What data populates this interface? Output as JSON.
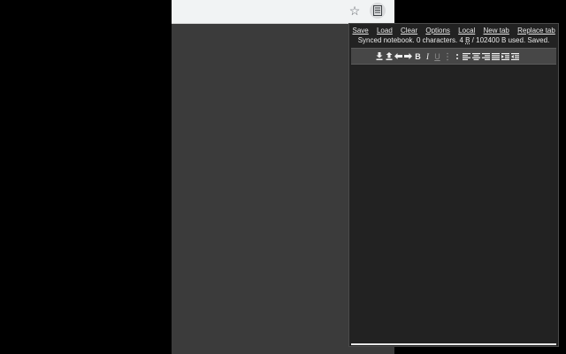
{
  "browser": {
    "bookmark_icon": "star-icon",
    "extension_icon": "notebook-icon"
  },
  "menu": {
    "save": "Save",
    "load": "Load",
    "clear": "Clear",
    "options": "Options",
    "local": "Local",
    "new_tab": "New tab",
    "replace_tab": "Replace tab"
  },
  "status": {
    "prefix": "Synced notebook. 0 characters. 4 ",
    "unit_b": "B",
    "suffix": " / 102400 B used. Saved."
  },
  "toolbar": {
    "items": [
      "download-icon",
      "upload-icon",
      "arrow-left-icon",
      "arrow-right-icon",
      "bold-icon",
      "italic-icon",
      "underline-icon",
      "list-icon",
      "more-icon",
      "align-left-icon",
      "align-center-icon",
      "align-right-icon",
      "align-justify-icon",
      "indent-icon",
      "outdent-icon"
    ],
    "bold_label": "B",
    "italic_label": "I",
    "underline_label": "U"
  },
  "editor": {
    "value": ""
  },
  "colors": {
    "background": "#000000",
    "panel": "#222222",
    "toolbar": "#474747",
    "text": "#e8e8e8"
  }
}
